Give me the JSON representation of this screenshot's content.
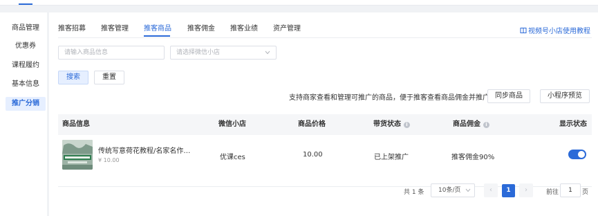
{
  "sidebar": {
    "items": [
      {
        "label": "商品管理"
      },
      {
        "label": "优惠券"
      },
      {
        "label": "课程履约"
      },
      {
        "label": "基本信息"
      },
      {
        "label": "推广分销"
      }
    ],
    "active_index": 4
  },
  "tabs": [
    {
      "label": "推客招募"
    },
    {
      "label": "推客管理"
    },
    {
      "label": "推客商品"
    },
    {
      "label": "推客佣金"
    },
    {
      "label": "推客业绩"
    },
    {
      "label": "资产管理"
    }
  ],
  "active_tab": 2,
  "help_link": {
    "label": "视频号小店使用教程",
    "icon": "book-icon"
  },
  "filters": {
    "product_input": {
      "placeholder": "请输入商品信息"
    },
    "shop_select": {
      "placeholder": "请选择微信小店"
    },
    "search_label": "搜索",
    "reset_label": "重置"
  },
  "notice": "支持商家查看和管理可推广的商品，便于推客查看商品佣金并推广商品",
  "actions": {
    "sync_label": "同步商品",
    "preview_label": "小程序预览"
  },
  "table": {
    "columns": [
      {
        "label": "商品信息"
      },
      {
        "label": "微信小店"
      },
      {
        "label": "商品价格"
      },
      {
        "label": "带货状态",
        "info": "i"
      },
      {
        "label": "商品佣金",
        "info": "i"
      },
      {
        "label": "显示状态"
      }
    ],
    "rows": [
      {
        "name": "传统写意荷花教程/名家名作…",
        "price_sub": "¥ 10.00",
        "shop": "优课ces",
        "price": "10.00",
        "status": "已上架推广",
        "commission": "推客佣金90%",
        "visible": true
      }
    ]
  },
  "pagination": {
    "total": "共 1 条",
    "page_size": "10条/页",
    "prev": "‹",
    "next": "›",
    "current": "1",
    "goto_label": "前往",
    "goto_value": "1",
    "goto_unit": "页"
  },
  "colors": {
    "accent": "#2b6ad8"
  }
}
